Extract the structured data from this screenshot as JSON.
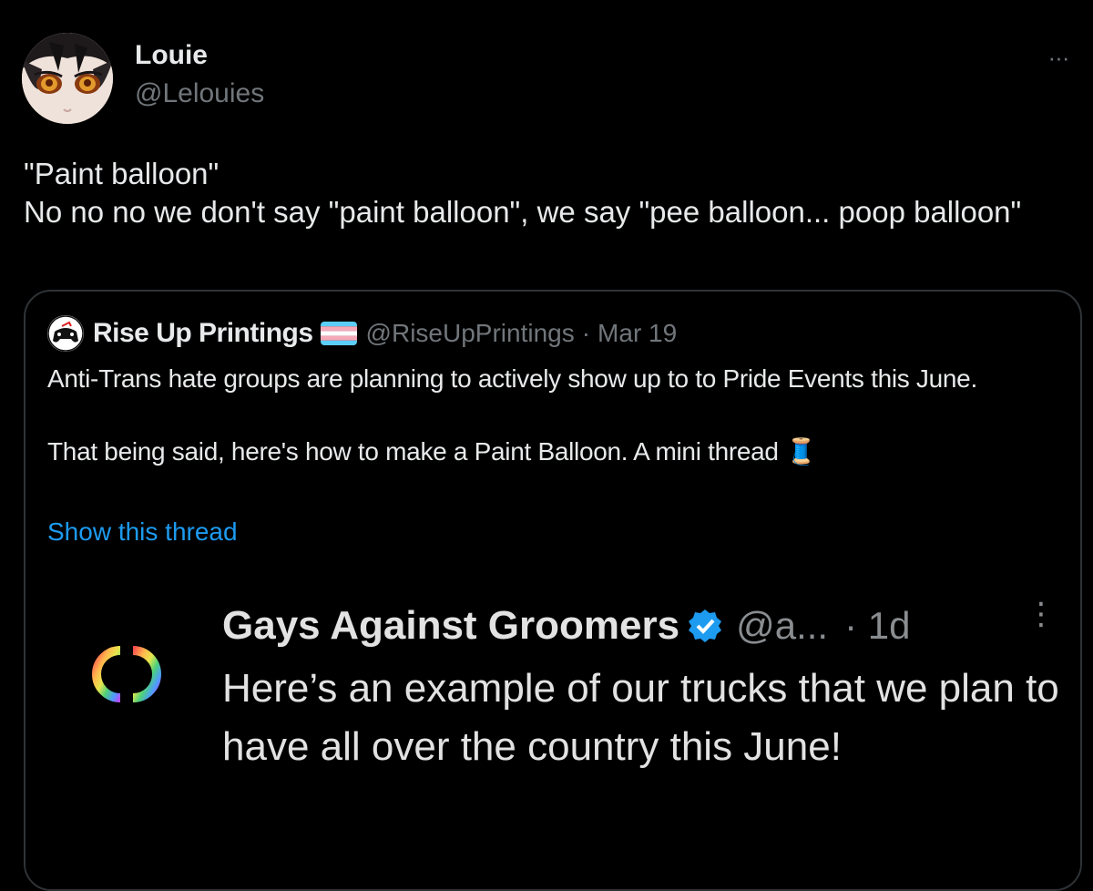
{
  "tweet": {
    "author": {
      "display_name": "Louie",
      "handle": "@Lelouies",
      "avatar_icon": "anime-character-avatar"
    },
    "more_icon": "more-horizontal-icon",
    "more_label": "···",
    "text_lines": [
      "\"Paint balloon\"",
      "No no no we don't say \"paint balloon\", we say \"pee balloon... poop balloon\""
    ]
  },
  "quoted_tweet": {
    "display_name": "Rise Up Printings",
    "flag_icon": "transgender-flag-icon",
    "handle": "@RiseUpPrintings",
    "separator": "·",
    "date": "Mar 19",
    "paragraph_1": "Anti-Trans hate groups are planning to actively show up to to Pride Events this June.",
    "paragraph_2": "That being said, here's how to make a Paint Balloon. A mini thread 🧵",
    "show_thread_label": "Show this thread",
    "media": {
      "display_name": "Gays Against Groomers",
      "verified_icon": "verified-badge-icon",
      "handle": "@a...",
      "time": "· 1d",
      "kebab": "⋮",
      "text": "Here’s an example of our trucks that we plan to have all over the country this June!"
    }
  },
  "colors": {
    "background": "#000000",
    "primary_text": "#e7e9ea",
    "secondary_text": "#71767b",
    "link": "#1d9bf0",
    "border": "#2f3336",
    "verified": "#1d9bf0"
  }
}
